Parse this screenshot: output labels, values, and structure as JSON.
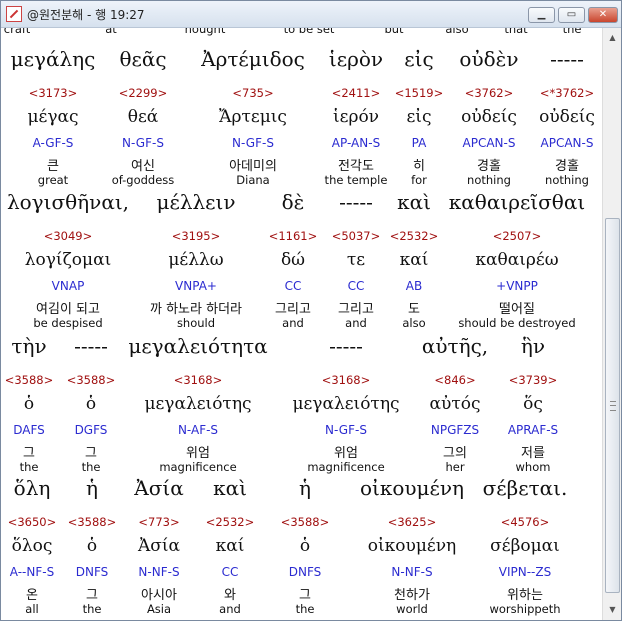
{
  "window": {
    "title": "@원전분해 - 행 19:27"
  },
  "controls": {
    "minimize": "▁",
    "maximize": "▭",
    "close": "✕"
  },
  "top_cut": [
    "craft",
    "at",
    "nought",
    "to be set",
    "but",
    "also",
    "that",
    "the"
  ],
  "blocks": [
    {
      "greek": [
        "μεγάλης",
        "θεᾶς",
        "Ἀρτέμιδος",
        "ἱερὸν",
        "εἰς",
        "οὐδὲν",
        "-----"
      ],
      "strong": [
        "<3173>",
        "<2299>",
        "<735>",
        "<2411>",
        "<1519>",
        "<3762>",
        "<*3762>"
      ],
      "lemma": [
        "μέγας",
        "θεά",
        "Ἄρτεμις",
        "ἱερόν",
        "εἰς",
        "οὐδείς",
        "οὐδείς"
      ],
      "parse": [
        "A-GF-S",
        "N-GF-S",
        "N-GF-S",
        "AP-AN-S",
        "PA",
        "APCAN-S",
        "APCAN-S"
      ],
      "korean": [
        "큰",
        "여신",
        "아데미의",
        "전각도",
        "히",
        "경홀",
        "경홀"
      ],
      "english": [
        "great",
        "of-goddess",
        "Diana",
        "the temple",
        "for",
        "nothing",
        "nothing"
      ]
    },
    {
      "greek": [
        "λογισθῆναι,",
        "μέλλειν",
        "δὲ",
        "-----",
        "καὶ",
        "καθαιρεῖσθαι"
      ],
      "strong": [
        "<3049>",
        "<3195>",
        "<1161>",
        "<5037>",
        "<2532>",
        "<2507>"
      ],
      "lemma": [
        "λογίζομαι",
        "μέλλω",
        "δώ",
        "τε",
        "καί",
        "καθαιρέω"
      ],
      "parse": [
        "VNAP",
        "VNPA+",
        "CC",
        "CC",
        "AB",
        "+VNPP"
      ],
      "korean": [
        "여김이 되고",
        "까 하노라 하더라",
        "그리고",
        "그리고",
        "도",
        "떨어질"
      ],
      "english": [
        "be despised",
        "should",
        "and",
        "and",
        "also",
        "should be destroyed"
      ]
    },
    {
      "greek": [
        "τὴν",
        "-----",
        "μεγαλειότητα",
        "-----",
        "αὐτῆς,",
        "ἣν"
      ],
      "strong": [
        "<3588>",
        "<3588>",
        "<3168>",
        "<3168>",
        "<846>",
        "<3739>"
      ],
      "lemma": [
        "ὁ",
        "ὁ",
        "μεγαλειότης",
        "μεγαλειότης",
        "αὐτός",
        "ὅς"
      ],
      "parse": [
        "DAFS",
        "DGFS",
        "N-AF-S",
        "N-GF-S",
        "NPGFZS",
        "APRAF-S"
      ],
      "korean": [
        "그",
        "그",
        "위엄",
        "위엄",
        "그의",
        "저를"
      ],
      "english": [
        "the",
        "the",
        "magnificence",
        "magnificence",
        "her",
        "whom"
      ]
    },
    {
      "greek": [
        "ὅλη",
        "ἡ",
        "Ἀσία",
        "καὶ",
        "ἡ",
        "οἰκουμένη",
        "σέβεται."
      ],
      "strong": [
        "<3650>",
        "<3588>",
        "<773>",
        "<2532>",
        "<3588>",
        "<3625>",
        "<4576>"
      ],
      "lemma": [
        "ὅλος",
        "ὁ",
        "Ἀσία",
        "καί",
        "ὁ",
        "οἰκουμένη",
        "σέβομαι"
      ],
      "parse": [
        "A--NF-S",
        "DNFS",
        "N-NF-S",
        "CC",
        "DNFS",
        "N-NF-S",
        "VIPN--ZS"
      ],
      "korean": [
        "온",
        "그",
        "아시아",
        "와",
        "그",
        "천하가",
        "위하는"
      ],
      "english": [
        "all",
        "the",
        "Asia",
        "and",
        "the",
        "world",
        "worshippeth"
      ]
    }
  ]
}
